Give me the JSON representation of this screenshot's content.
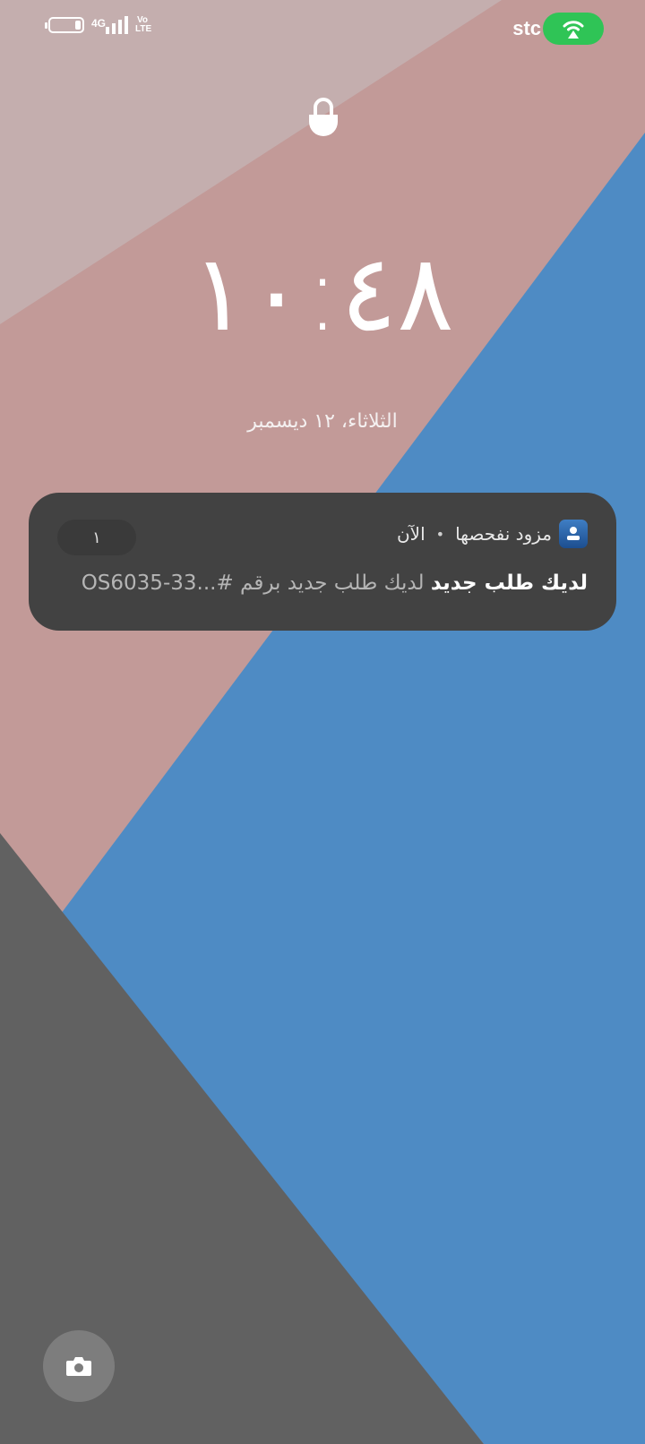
{
  "status_bar": {
    "network_type": "4G",
    "volte": "Vo LTE",
    "carrier": "stc",
    "battery_level": 0.15,
    "signal_bars": 4
  },
  "lockscreen": {
    "time": "١٠:٤٨",
    "date": "الثلاثاء، ١٢ ديسمبر"
  },
  "notification": {
    "app_name": "مزود نفحصها",
    "time_label": "الآن",
    "count": "١",
    "title": "لديك طلب جديد",
    "text": "لديك طلب جديد برقم #...OS6035-33",
    "app_icon": "app-logo-icon"
  },
  "colors": {
    "wall_top": "#c4aaaa",
    "wall_pink": "#c29a98",
    "wall_blue": "#4e8bc4",
    "wall_gray": "#616161",
    "notification_bg": "#424242",
    "hotspot_green": "#2fc456"
  }
}
